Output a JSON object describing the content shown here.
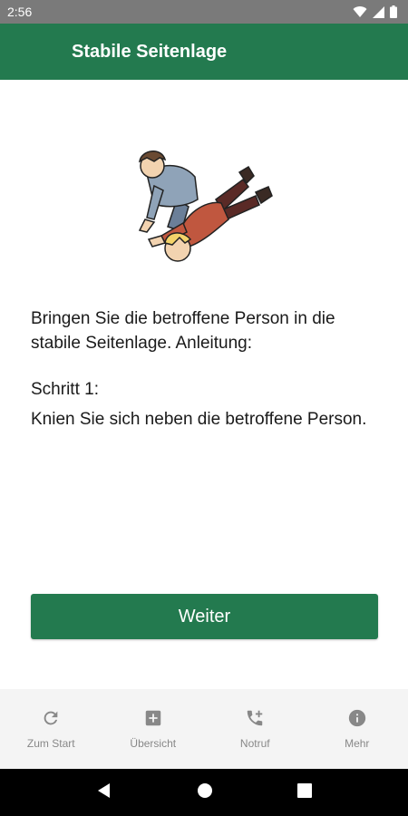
{
  "status_bar": {
    "time": "2:56"
  },
  "app_bar": {
    "title": "Stabile Seitenlage"
  },
  "content": {
    "intro": "Bringen Sie die betroffene Person in die stabile Seitenlage. Anleitung:",
    "step_label": "Schritt 1:",
    "step_text": "Knien Sie sich neben die betroffene Person."
  },
  "next_button": {
    "label": "Weiter"
  },
  "bottom_nav": {
    "items": [
      {
        "label": "Zum Start",
        "icon": "refresh-icon"
      },
      {
        "label": "Übersicht",
        "icon": "plus-box-icon"
      },
      {
        "label": "Notruf",
        "icon": "phone-add-icon"
      },
      {
        "label": "Mehr",
        "icon": "info-icon"
      }
    ]
  },
  "colors": {
    "primary": "#237a4f",
    "status_bar": "#7a7a7a",
    "nav_bg": "#f4f4f4",
    "nav_text": "#888888"
  }
}
